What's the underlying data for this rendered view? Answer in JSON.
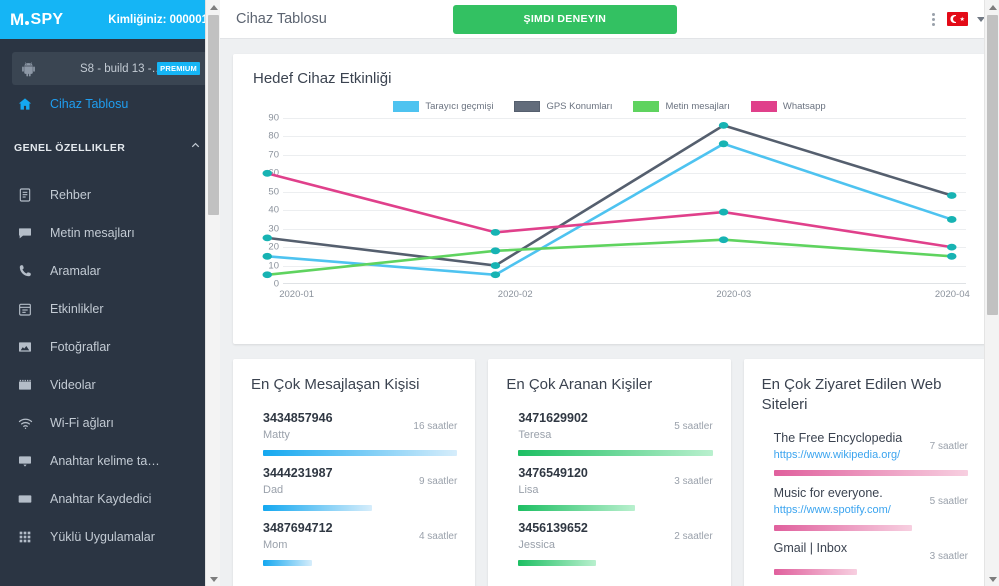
{
  "sidebar": {
    "logo": "mSPY",
    "uid_label": "Kimliğiniz: 000001",
    "device": {
      "label": "S8 - build 13 -…",
      "badge": "PREMIUM"
    },
    "dashboard_item": "Cihaz Tablosu",
    "section_title": "GENEL ÖZELLIKLER",
    "items": [
      {
        "label": "Rehber",
        "icon": "contacts-icon"
      },
      {
        "label": "Metin mesajları",
        "icon": "sms-icon"
      },
      {
        "label": "Aramalar",
        "icon": "phone-icon"
      },
      {
        "label": "Etkinlikler",
        "icon": "calendar-icon"
      },
      {
        "label": "Fotoğraflar",
        "icon": "photo-icon"
      },
      {
        "label": "Videolar",
        "icon": "video-icon"
      },
      {
        "label": "Wi-Fi ağları",
        "icon": "wifi-icon"
      },
      {
        "label": "Anahtar kelime ta…",
        "icon": "keyword-icon"
      },
      {
        "label": "Anahtar Kaydedici",
        "icon": "keylogger-icon"
      },
      {
        "label": "Yüklü Uygulamalar",
        "icon": "apps-grid-icon"
      }
    ]
  },
  "topbar": {
    "title": "Cihaz Tablosu",
    "cta_label": "ŞIMDI DENEYIN",
    "menu_icon": "kebab-menu-icon",
    "flag_icon": "turkish-flag-icon",
    "caret_icon": "chevron-down-icon"
  },
  "chart_data": {
    "type": "line",
    "title": "Hedef Cihaz Etkinliği",
    "xlabel": "",
    "ylabel": "",
    "ylim": [
      0,
      90
    ],
    "yticks": [
      0,
      10,
      20,
      30,
      40,
      50,
      60,
      70,
      80,
      90
    ],
    "grid": true,
    "legend_position": "top-center",
    "categories": [
      "2020-01",
      "2020-02",
      "2020-03",
      "2020-04"
    ],
    "series": [
      {
        "name": "Tarayıcı geçmişi",
        "color": "#4ec3f0",
        "values": [
          15,
          5,
          76,
          35
        ]
      },
      {
        "name": "GPS Konumları",
        "color": "#555f6e",
        "values": [
          25,
          10,
          86,
          48
        ]
      },
      {
        "name": "Metin mesajları",
        "color": "#5fd35f",
        "values": [
          5,
          18,
          24,
          15
        ]
      },
      {
        "name": "Whatsapp",
        "color": "#e0408b",
        "values": [
          60,
          28,
          39,
          20
        ]
      }
    ],
    "marker_color": "#17b3b3"
  },
  "cards": [
    {
      "title": "En Çok Mesajlaşan Kişisi",
      "accent": "#14a8f0",
      "accent_light": "#d6edfb",
      "entries": [
        {
          "primary": "3434857946",
          "secondary": "Matty",
          "hours": "16 saatler",
          "pct": 100
        },
        {
          "primary": "3444231987",
          "secondary": "Dad",
          "hours": "9 saatler",
          "pct": 56
        },
        {
          "primary": "3487694712",
          "secondary": "Mom",
          "hours": "4 saatler",
          "pct": 25
        }
      ]
    },
    {
      "title": "En Çok Aranan Kişiler",
      "accent": "#1dbf63",
      "accent_light": "#b9f0ce",
      "entries": [
        {
          "primary": "3471629902",
          "secondary": "Teresa",
          "hours": "5 saatler",
          "pct": 100
        },
        {
          "primary": "3476549120",
          "secondary": "Lisa",
          "hours": "3 saatler",
          "pct": 60
        },
        {
          "primary": "3456139652",
          "secondary": "Jessica",
          "hours": "2 saatler",
          "pct": 40
        }
      ]
    },
    {
      "title": "En Çok Ziyaret Edilen Web Siteleri",
      "accent": "#e0609d",
      "accent_light": "#f7cfe0",
      "entries": [
        {
          "primary": "The Free Encyclopedia",
          "secondary": "https://www.wikipedia.org/",
          "hours": "7 saatler",
          "pct": 100
        },
        {
          "primary": "Music for everyone.",
          "secondary": "https://www.spotify.com/",
          "hours": "5 saatler",
          "pct": 71
        },
        {
          "primary": "Gmail | Inbox",
          "secondary": "",
          "hours": "3 saatler",
          "pct": 43
        }
      ]
    }
  ]
}
